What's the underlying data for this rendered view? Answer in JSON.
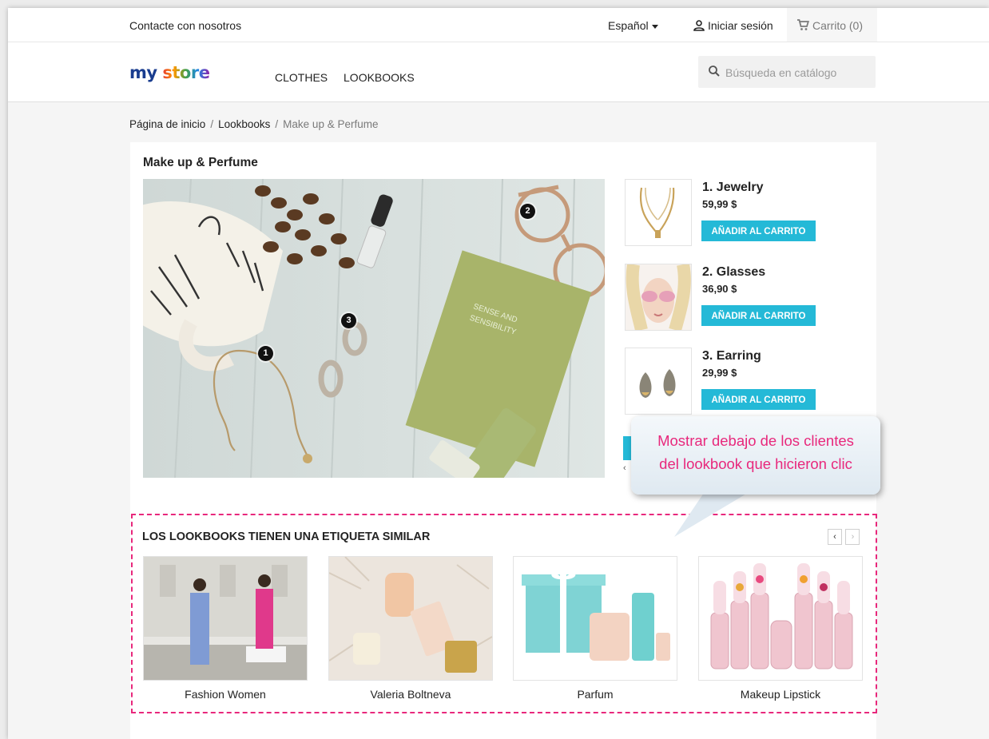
{
  "topbar": {
    "contact": "Contacte con nosotros",
    "language": "Español",
    "login": "Iniciar sesión",
    "cart": "Carrito (0)"
  },
  "header": {
    "logo": {
      "part1": "my",
      "part2": "store"
    },
    "nav": [
      "CLOTHES",
      "LOOKBOOKS"
    ],
    "search_placeholder": "Búsqueda en catálogo"
  },
  "breadcrumb": {
    "items": [
      "Página de inicio",
      "Lookbooks",
      "Make up & Perfume"
    ],
    "separator": "/"
  },
  "lookbook": {
    "title": "Make up & Perfume",
    "hotspots": [
      "1",
      "2",
      "3"
    ],
    "products": [
      {
        "name": "1. Jewelry",
        "price": "59,99 $",
        "button": "AÑADIR AL CARRITO"
      },
      {
        "name": "2. Glasses",
        "price": "36,90 $",
        "button": "AÑADIR AL CARRITO"
      },
      {
        "name": "3. Earring",
        "price": "29,99 $",
        "button": "AÑADIR AL CARRITO"
      }
    ]
  },
  "callout": {
    "line1": "Mostrar debajo de los clientes",
    "line2": "del lookbook que hicieron clic"
  },
  "similar": {
    "title": "LOS LOOKBOOKS TIENEN UNA ETIQUETA SIMILAR",
    "items": [
      {
        "caption": "Fashion Women"
      },
      {
        "caption": "Valeria Boltneva"
      },
      {
        "caption": "Parfum"
      },
      {
        "caption": "Makeup Lipstick"
      }
    ]
  },
  "colors": {
    "accent": "#24b9d7",
    "callout_text": "#e8287c",
    "dash_border": "#e8287c"
  }
}
